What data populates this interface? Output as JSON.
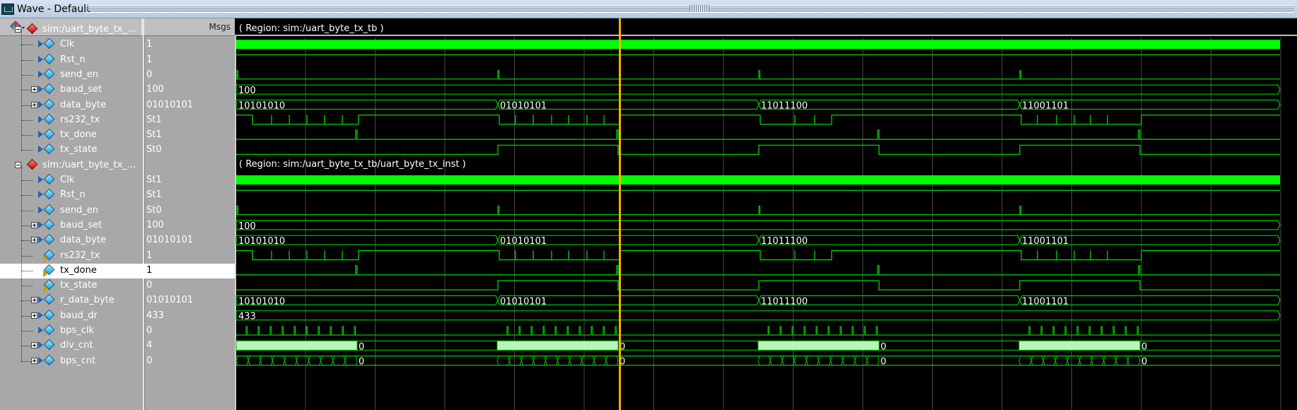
{
  "window": {
    "title": "Wave - Default"
  },
  "header": {
    "msgs_label": "Msgs"
  },
  "signals": [
    {
      "name": "sim:/uart_byte_tx_...",
      "value": "",
      "kind": "group",
      "indent": 0
    },
    {
      "name": "Clk",
      "value": "1",
      "kind": "in",
      "indent": 1
    },
    {
      "name": "Rst_n",
      "value": "1",
      "kind": "in",
      "indent": 1
    },
    {
      "name": "send_en",
      "value": "0",
      "kind": "in",
      "indent": 1
    },
    {
      "name": "baud_set",
      "value": "100",
      "kind": "bus",
      "indent": 1
    },
    {
      "name": "data_byte",
      "value": "01010101",
      "kind": "bus",
      "indent": 1
    },
    {
      "name": "rs232_tx",
      "value": "St1",
      "kind": "in",
      "indent": 1
    },
    {
      "name": "tx_done",
      "value": "St1",
      "kind": "in",
      "indent": 1
    },
    {
      "name": "tx_state",
      "value": "St0",
      "kind": "in",
      "indent": 1
    },
    {
      "name": "sim:/uart_byte_tx_...",
      "value": "",
      "kind": "group",
      "indent": 0
    },
    {
      "name": "Clk",
      "value": "St1",
      "kind": "in",
      "indent": 1
    },
    {
      "name": "Rst_n",
      "value": "St1",
      "kind": "in",
      "indent": 1
    },
    {
      "name": "send_en",
      "value": "St0",
      "kind": "in",
      "indent": 1
    },
    {
      "name": "baud_set",
      "value": "100",
      "kind": "bus",
      "indent": 1
    },
    {
      "name": "data_byte",
      "value": "01010101",
      "kind": "bus",
      "indent": 1
    },
    {
      "name": "rs232_tx",
      "value": "1",
      "kind": "out",
      "indent": 1
    },
    {
      "name": "tx_done",
      "value": "1",
      "kind": "out",
      "indent": 1,
      "selected": true
    },
    {
      "name": "tx_state",
      "value": "0",
      "kind": "out",
      "indent": 1
    },
    {
      "name": "r_data_byte",
      "value": "01010101",
      "kind": "bus",
      "indent": 1
    },
    {
      "name": "baud_dr",
      "value": "433",
      "kind": "bus",
      "indent": 1
    },
    {
      "name": "bps_clk",
      "value": "0",
      "kind": "in",
      "indent": 1
    },
    {
      "name": "div_cnt",
      "value": "4",
      "kind": "bus",
      "indent": 1
    },
    {
      "name": "bps_cnt",
      "value": "0",
      "kind": "bus",
      "indent": 1
    }
  ],
  "regions": [
    {
      "row": 0,
      "text": "( Region: sim:/uart_byte_tx_tb )"
    },
    {
      "row": 9,
      "text": "( Region: sim:/uart_byte_tx_tb/uart_byte_tx_inst )"
    }
  ],
  "bus_labels": {
    "baud_set": [
      "100"
    ],
    "data_byte": [
      "10101010",
      "01010101",
      "11011100",
      "11001101"
    ],
    "r_data_byte": [
      "10101010",
      "01010101",
      "11011100",
      "11001101"
    ],
    "baud_dr": [
      "433"
    ],
    "div_cnt": [
      "0",
      "0",
      "0",
      "0"
    ],
    "bps_cnt": [
      "0",
      "0",
      "0",
      "0"
    ]
  },
  "colors": {
    "wave": "#00c800",
    "clock_fill": "#00ff00",
    "bus_fill": "#b8f5b8",
    "cursor": "#ffb000",
    "grid": "#4a4a4a"
  },
  "icons": {
    "group": "red-diamond-icon",
    "signal": "blue-diamond-icon",
    "output": "yellow-arrow-icon"
  }
}
